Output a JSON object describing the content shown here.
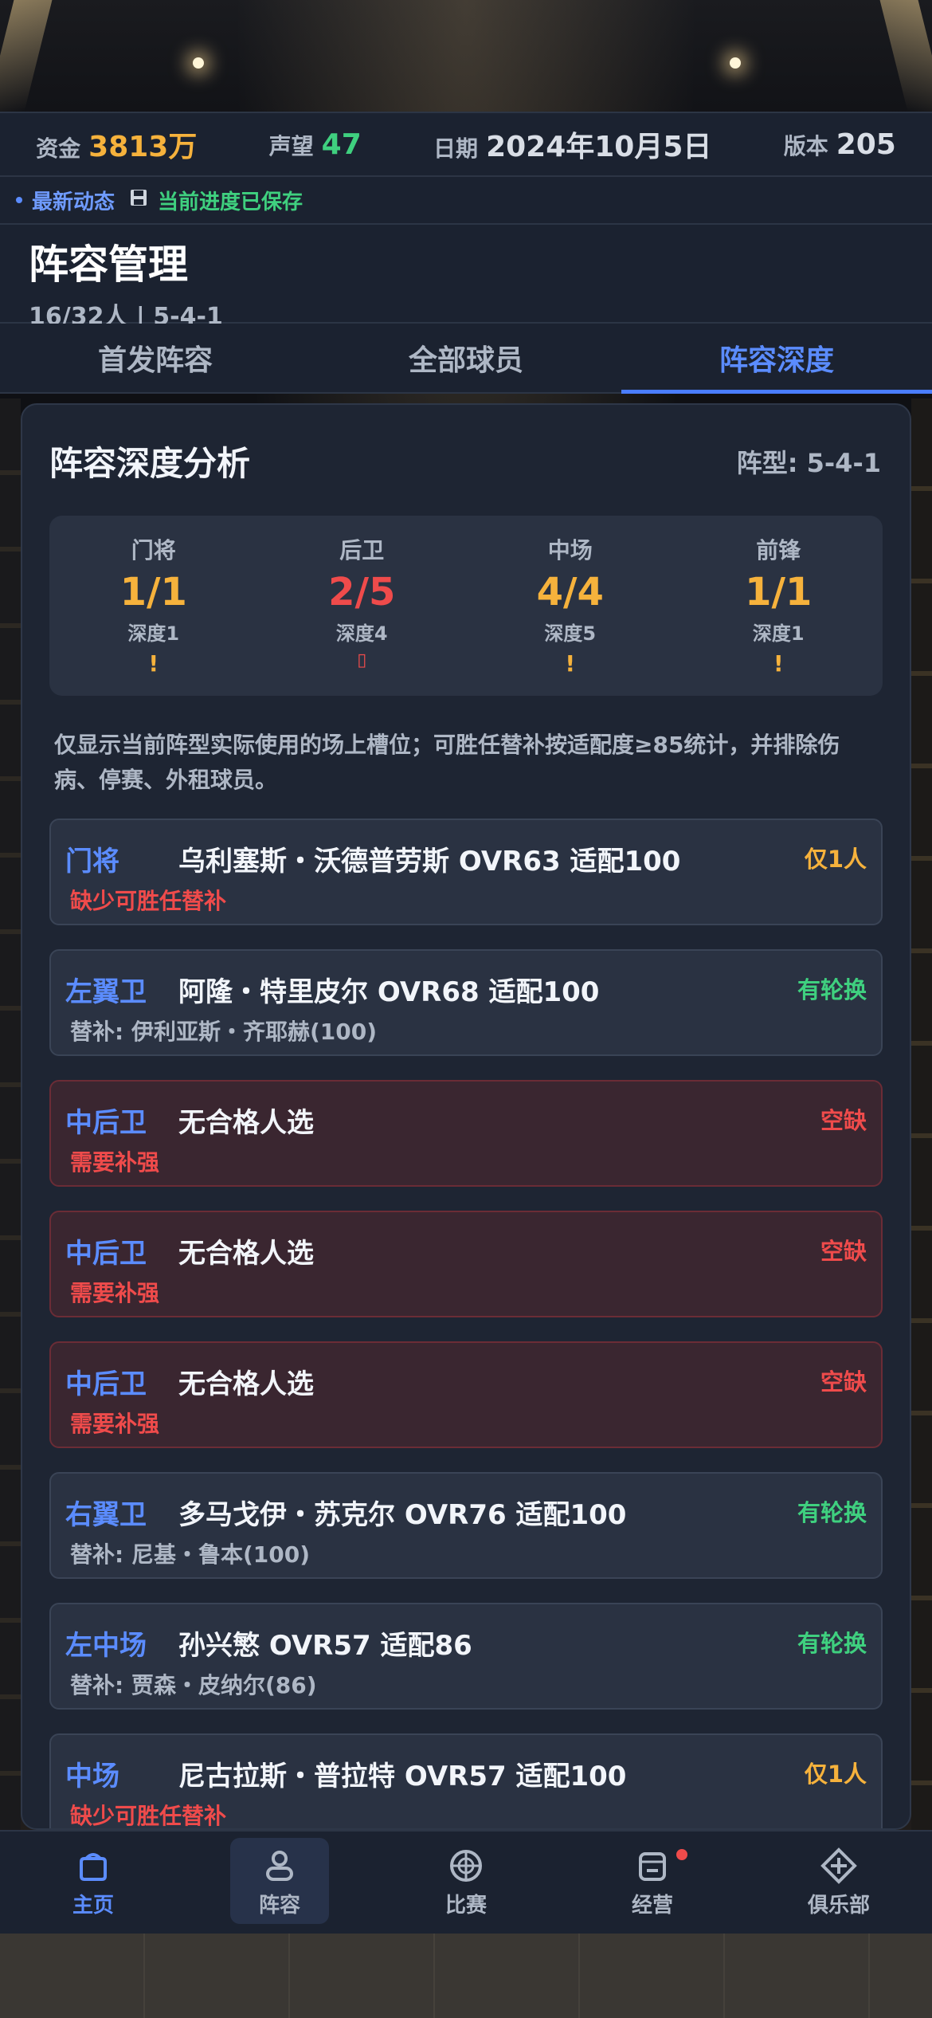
{
  "stats": {
    "funds_label": "资金",
    "funds_value": "3813万",
    "reputation_label": "声望",
    "reputation_value": "47",
    "date_label": "日期",
    "date_value": "2024年10月5日",
    "version_label": "版本",
    "version_value": "205"
  },
  "news": {
    "label": "最新动态",
    "save_icon": "floppy-icon",
    "saved_text": "当前进度已保存"
  },
  "header": {
    "title": "阵容管理",
    "subtitle": "16/32人 | 5-4-1"
  },
  "tabs": [
    {
      "label": "首发阵容",
      "active": false
    },
    {
      "label": "全部球员",
      "active": false
    },
    {
      "label": "阵容深度",
      "active": true
    }
  ],
  "panel": {
    "title": "阵容深度分析",
    "formation": "阵型: 5-4-1",
    "summary": [
      {
        "pos": "门将",
        "ratio": "1/1",
        "depth": "深度1",
        "warn": "!",
        "color": "#f6b23c"
      },
      {
        "pos": "后卫",
        "ratio": "2/5",
        "depth": "深度4",
        "warn": "▯",
        "color": "#ef4b4b"
      },
      {
        "pos": "中场",
        "ratio": "4/4",
        "depth": "深度5",
        "warn": "!",
        "color": "#f6b23c"
      },
      {
        "pos": "前锋",
        "ratio": "1/1",
        "depth": "深度1",
        "warn": "!",
        "color": "#f6b23c"
      }
    ],
    "note": "仅显示当前阵型实际使用的场上槽位；可胜任替补按适配度≥85统计，并排除伤病、停赛、外租球员。",
    "slots": [
      {
        "pos": "门将",
        "player": "乌利塞斯・沃德普劳斯 OVR63 适配100",
        "sub": "缺少可胜任替补",
        "status": "仅1人",
        "type": "only"
      },
      {
        "pos": "左翼卫",
        "player": "阿隆・特里皮尔 OVR68 适配100",
        "sub": "替补: 伊利亚斯・齐耶赫(100)",
        "status": "有轮换",
        "type": "rotation"
      },
      {
        "pos": "中后卫",
        "player": "无合格人选",
        "sub": "需要补强",
        "status": "空缺",
        "type": "empty"
      },
      {
        "pos": "中后卫",
        "player": "无合格人选",
        "sub": "需要补强",
        "status": "空缺",
        "type": "empty"
      },
      {
        "pos": "中后卫",
        "player": "无合格人选",
        "sub": "需要补强",
        "status": "空缺",
        "type": "empty"
      },
      {
        "pos": "右翼卫",
        "player": "多马戈伊・苏克尔 OVR76 适配100",
        "sub": "替补: 尼基・鲁本(100)",
        "status": "有轮换",
        "type": "rotation"
      },
      {
        "pos": "左中场",
        "player": "孙兴慜 OVR57 适配86",
        "sub": "替补: 贾森・皮纳尔(86)",
        "status": "有轮换",
        "type": "rotation"
      },
      {
        "pos": "中场",
        "player": "尼古拉斯・普拉特 OVR57 适配100",
        "sub": "缺少可胜任替补",
        "status": "仅1人",
        "type": "only"
      }
    ]
  },
  "nav": [
    {
      "label": "主页",
      "icon": "home-icon"
    },
    {
      "label": "阵容",
      "icon": "user-icon"
    },
    {
      "label": "比赛",
      "icon": "ball-icon"
    },
    {
      "label": "经营",
      "icon": "calendar-icon"
    },
    {
      "label": "俱乐部",
      "icon": "club-icon"
    }
  ],
  "colors": {
    "accent": "#5b8cff",
    "gold": "#f6b23c",
    "green": "#3fd07f",
    "red": "#ef4b4b"
  }
}
